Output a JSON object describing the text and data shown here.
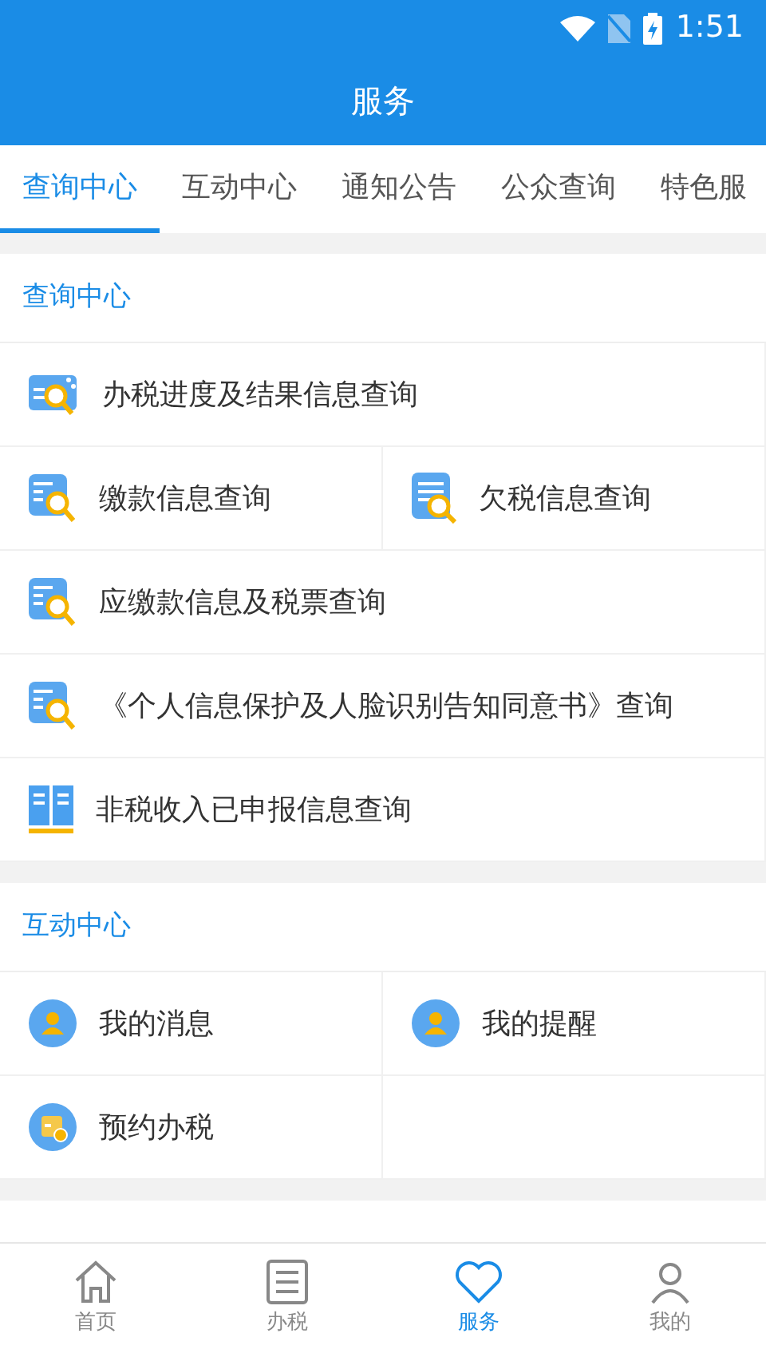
{
  "status_bar": {
    "time": "1:51"
  },
  "app_bar": {
    "title": "服务"
  },
  "tabs": [
    {
      "label": "查询中心",
      "selected": true
    },
    {
      "label": "互动中心",
      "selected": false
    },
    {
      "label": "通知公告",
      "selected": false
    },
    {
      "label": "公众查询",
      "selected": false
    },
    {
      "label": "特色服",
      "selected": false
    }
  ],
  "sections": [
    {
      "title": "查询中心",
      "items": [
        {
          "label": "办税进度及结果信息查询",
          "kind": "progress",
          "wide": true
        },
        {
          "label": "缴款信息查询",
          "kind": "doc",
          "wide": false
        },
        {
          "label": "欠税信息查询",
          "kind": "list",
          "wide": false
        },
        {
          "label": "应缴款信息及税票查询",
          "kind": "doc",
          "wide": true
        },
        {
          "label": "《个人信息保护及人脸识别告知同意书》查询",
          "kind": "doc",
          "wide": true
        },
        {
          "label": "非税收入已申报信息查询",
          "kind": "book",
          "wide": true
        }
      ]
    },
    {
      "title": "互动中心",
      "items": [
        {
          "label": "我的消息",
          "kind": "user",
          "wide": false
        },
        {
          "label": "我的提醒",
          "kind": "user",
          "wide": false
        },
        {
          "label": "预约办税",
          "kind": "calendar",
          "wide": false
        }
      ]
    }
  ],
  "bottom_nav": [
    {
      "label": "首页",
      "kind": "home",
      "selected": false
    },
    {
      "label": "办税",
      "kind": "list",
      "selected": false
    },
    {
      "label": "服务",
      "kind": "heart",
      "selected": true
    },
    {
      "label": "我的",
      "kind": "person",
      "selected": false
    }
  ]
}
